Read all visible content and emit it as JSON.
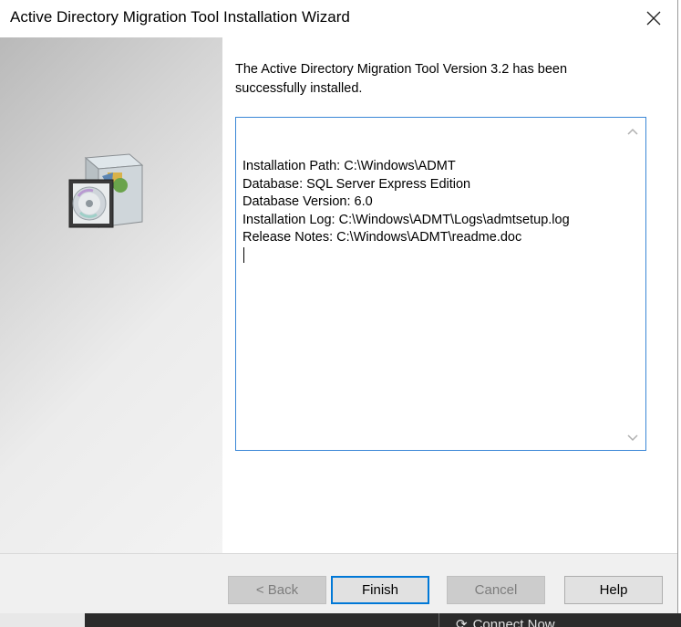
{
  "window": {
    "title": "Active Directory Migration Tool Installation Wizard"
  },
  "content": {
    "message": "The Active Directory Migration Tool Version 3.2 has been successfully installed.",
    "details": [
      "Installation Path: C:\\Windows\\ADMT",
      "Database: SQL Server Express Edition",
      "Database Version: 6.0",
      "Installation Log: C:\\Windows\\ADMT\\Logs\\admtsetup.log",
      "Release Notes: C:\\Windows\\ADMT\\readme.doc"
    ]
  },
  "buttons": {
    "back": "< Back",
    "finish": "Finish",
    "cancel": "Cancel",
    "help": "Help"
  },
  "taskbar": {
    "item_label": "Connect Now"
  },
  "icons": {
    "close": "close-icon",
    "installer": "installer-box-icon",
    "taskbar_item": "connect-icon"
  },
  "colors": {
    "focus_border": "#0078d7",
    "textarea_border": "#3a87d6"
  }
}
